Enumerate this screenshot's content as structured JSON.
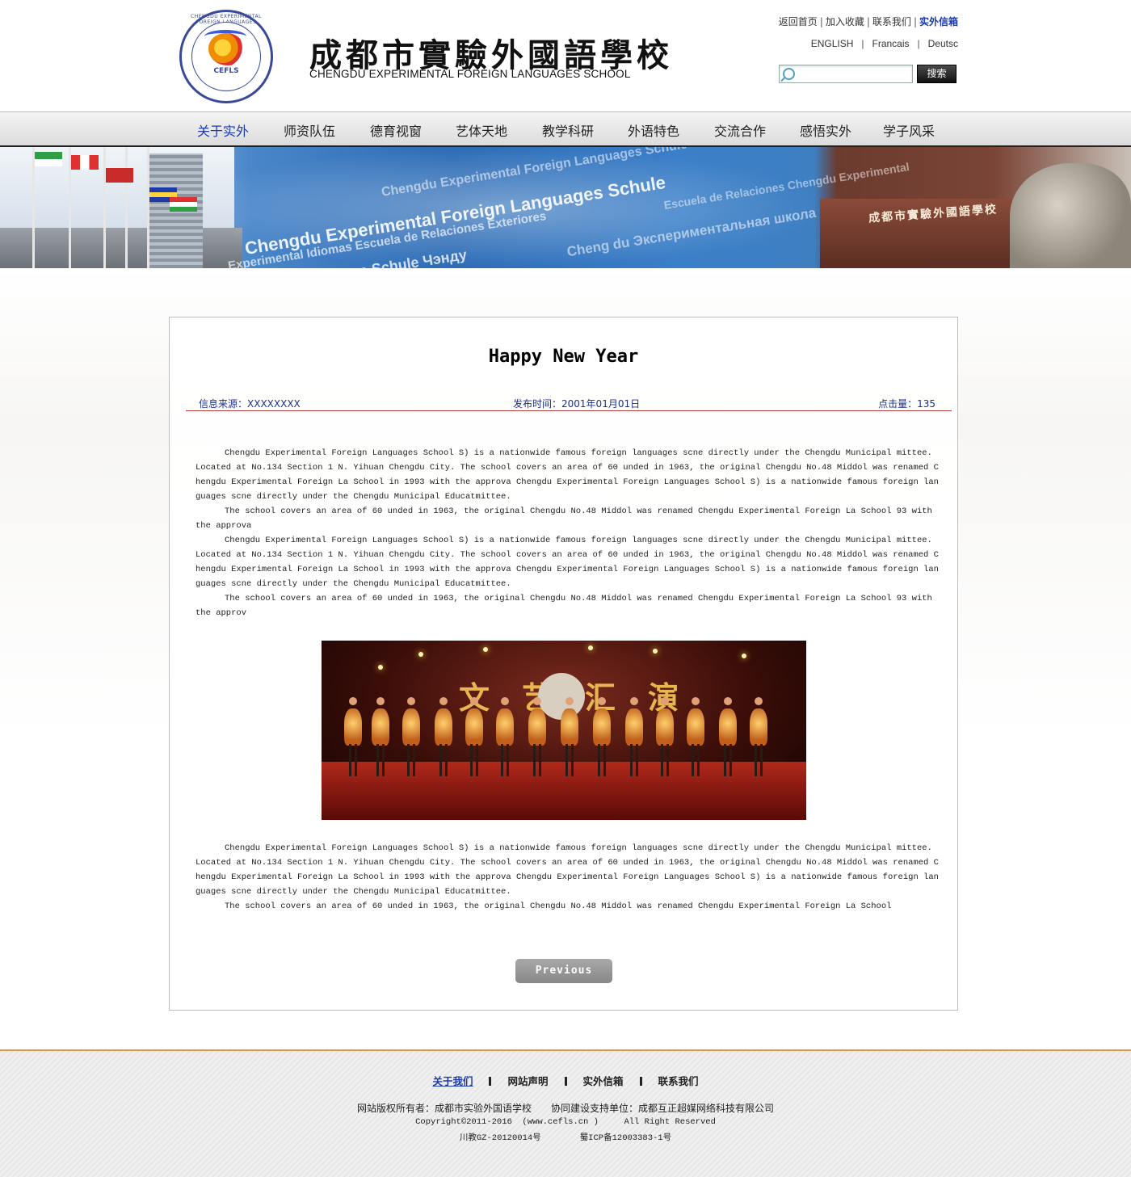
{
  "header": {
    "school_name_cn": "成都市實驗外國語學校",
    "school_name_en": "CHENGDU EXPERIMENTAL FOREIGN LANGUAGES SCHOOL",
    "logo_abbr": "CEFLS",
    "logo_ring_text": "CHENGDU EXPERIMENTAL FOREIGN LANGUAGES SCHOOL",
    "top_links": [
      "返回首页",
      "加入收藏",
      "联系我们",
      "实外信箱"
    ],
    "lang_links": [
      "ENGLISH",
      "Francais",
      "Deutsc"
    ],
    "search": {
      "placeholder": "",
      "button_label": "搜索"
    }
  },
  "nav": {
    "items": [
      "关于实外",
      "师资队伍",
      "德育视窗",
      "艺体天地",
      "教学科研",
      "外语特色",
      "交流合作",
      "感悟实外",
      "学子风采"
    ],
    "active_index": 0
  },
  "banner": {
    "gate_sign": "成都市實驗外國語學校"
  },
  "article": {
    "title": "Happy New Year",
    "source_label": "信息来源：",
    "source_value": "XXXXXXXX",
    "date_label": "发布时间：",
    "date_value": "2001年01月01日",
    "hits_label": "点击量：",
    "hits_value": "135",
    "paragraphs_top": [
      "Chengdu Experimental Foreign Languages School S) is a nationwide famous foreign languages scne directly under the Chengdu Municipal mittee. Located at No.134 Section 1 N. Yihuan Chengdu City. The school covers an area of 60 unded in 1963, the original Chengdu No.48 Middol was renamed Chengdu Experimental Foreign La School in 1993 with the approva Chengdu Experimental Foreign Languages School S) is a nationwide famous foreign languages scne directly under the Chengdu Municipal Educatmittee.",
      "The school covers an area of 60 unded in 1963, the original Chengdu No.48 Middol was renamed Chengdu Experimental Foreign La School 93 with the approva",
      "Chengdu Experimental Foreign Languages School S) is a nationwide famous foreign languages scne directly under the Chengdu Municipal mittee. Located at No.134 Section 1 N. Yihuan Chengdu City. The school covers an area of 60 unded in 1963, the original Chengdu No.48 Middol was renamed Chengdu Experimental Foreign La School in 1993 with the approva Chengdu Experimental Foreign Languages School S) is a nationwide famous foreign languages scne directly under the Chengdu Municipal Educatmittee.",
      "The school covers an area of 60 unded in 1963, the original Chengdu No.48 Middol was renamed Chengdu Experimental Foreign La School 93 with the approv"
    ],
    "photo_banner_text": "文艺汇演",
    "paragraphs_bottom": [
      "Chengdu Experimental Foreign Languages School S) is a nationwide famous foreign languages scne directly under the Chengdu Municipal mittee. Located at No.134 Section 1 N. Yihuan Chengdu City. The school covers an area of 60 unded in 1963, the original Chengdu No.48 Middol was renamed Chengdu Experimental Foreign La School in 1993 with the approva Chengdu Experimental Foreign Languages School S) is a nationwide famous foreign languages scne directly under the Chengdu Municipal Educatmittee.",
      "The school covers an area of 60 unded in 1963, the original Chengdu No.48 Middol was renamed Chengdu Experimental Foreign La School"
    ],
    "prev_label": "Previous"
  },
  "footer": {
    "links": [
      "关于我们",
      "网站声明",
      "实外信箱",
      "联系我们"
    ],
    "owner": "网站版权所有者：成都市实验外国语学校",
    "builder": "协同建设支持单位：成都互正超媒网络科技有限公司",
    "copyright": "Copyright©2011-2016  (www.cefls.cn )     All Right Reserved",
    "record1": "川教GZ-20120014号",
    "record2": "蜀ICP备12003383-1号"
  },
  "colors": {
    "accent_blue": "#1c3aa9",
    "footer_orange": "#e39b4a",
    "meta_rule_red": "#b23b3b"
  }
}
